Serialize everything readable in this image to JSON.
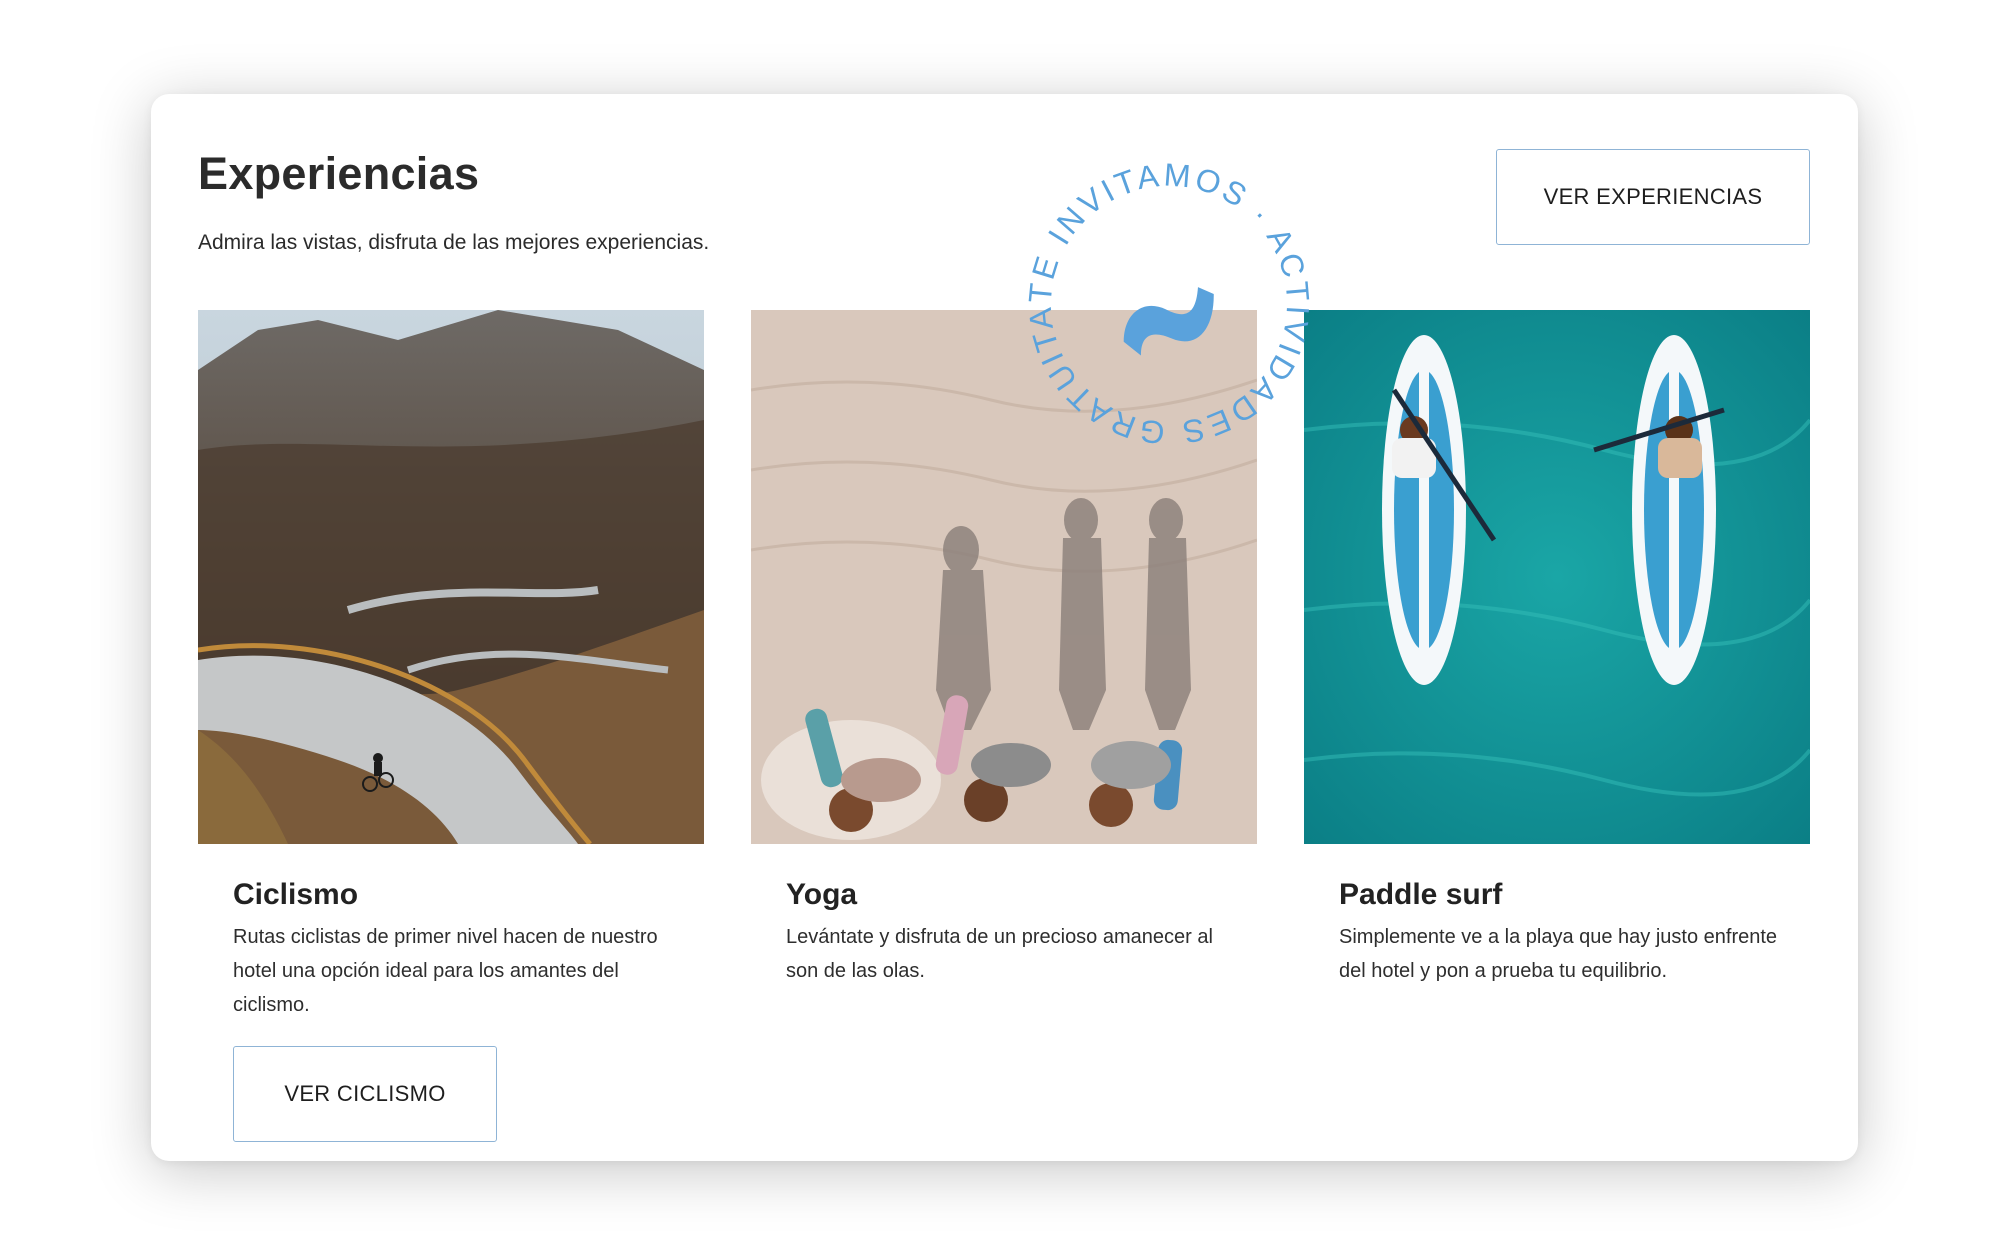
{
  "header": {
    "title": "Experiencias",
    "subtitle": "Admira las vistas, disfruta de las mejores experiencias.",
    "cta_label": "VER EXPERIENCIAS"
  },
  "badge": {
    "text": "TE INVITAMOS · ACTIVIDADES GRATUITAS ·",
    "color": "#5aa2dc",
    "icon": "wave-icon"
  },
  "experiences": [
    {
      "title": "Ciclismo",
      "description": "Rutas ciclistas de primer nivel hacen de nuestro hotel una opción ideal para los amantes del ciclismo.",
      "button_label": "VER CICLISMO",
      "image": "cyclist-mountain-road-image"
    },
    {
      "title": "Yoga",
      "description": "Levántate y disfruta de un precioso amanecer al son de las olas.",
      "image": "yoga-beach-shadows-image"
    },
    {
      "title": "Paddle surf",
      "description": "Simplemente ve a la playa que hay justo enfrente del hotel y pon a prueba tu equilibrio.",
      "image": "paddle-surf-aerial-image"
    }
  ],
  "colors": {
    "button_border": "#8fb4d6",
    "text": "#222222",
    "badge": "#5aa2dc"
  }
}
